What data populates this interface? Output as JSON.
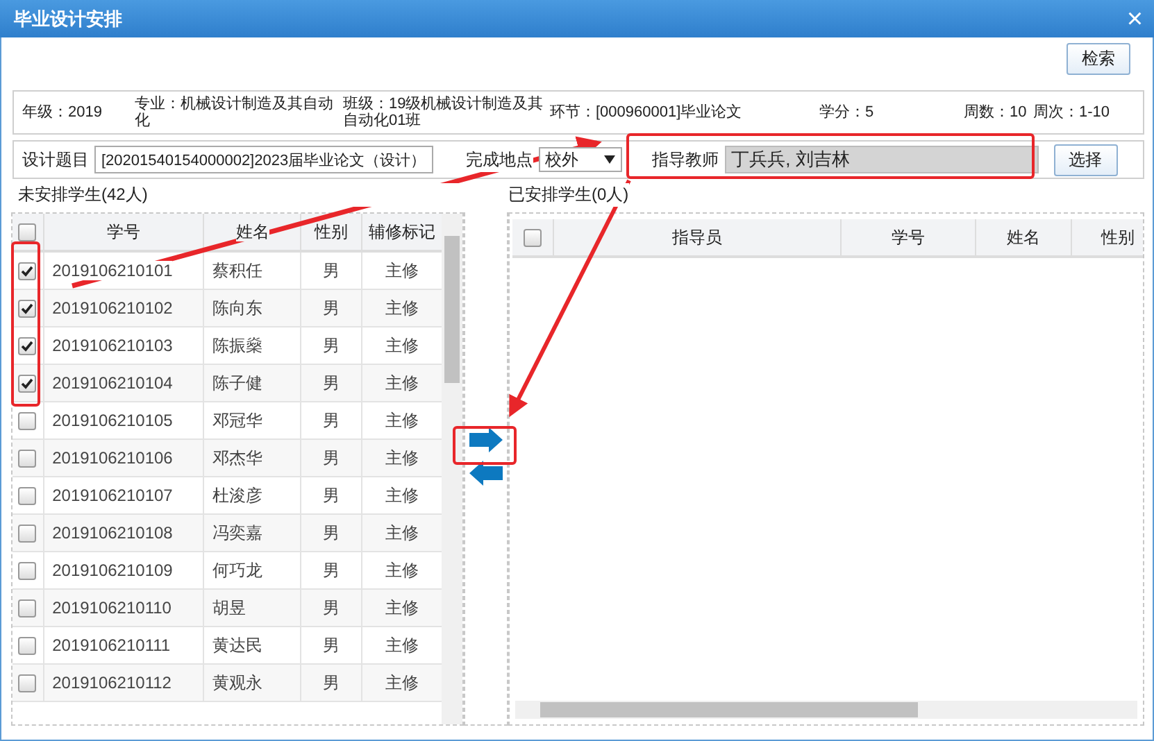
{
  "window": {
    "title": "毕业设计安排",
    "close": "×"
  },
  "toolbar": {
    "search_button": "检索"
  },
  "info": [
    "年级：2019",
    "专业：机械设计制造及其自动化",
    "班级：19级机械设计制造及其自动化01班",
    "环节：[000960001]毕业论文",
    "学分：5",
    "周数：10",
    "周次：1-10"
  ],
  "form": {
    "topic_label": "设计题目",
    "topic_value": "[20201540154000002]2023届毕业论文（设计）",
    "place_label": "完成地点",
    "place_value": "校外",
    "teacher_label": "指导教师",
    "teacher_value": "丁兵兵, 刘吉林",
    "select_button": "选择"
  },
  "unassigned": {
    "title": "未安排学生(42人)",
    "all_checked": false,
    "columns": [
      "学号",
      "姓名",
      "性别",
      "辅修标记"
    ],
    "rows": [
      {
        "id": "2019106210101",
        "name": "蔡积任",
        "gender": "男",
        "mark": "主修",
        "checked": true
      },
      {
        "id": "2019106210102",
        "name": "陈向东",
        "gender": "男",
        "mark": "主修",
        "checked": true
      },
      {
        "id": "2019106210103",
        "name": "陈振燊",
        "gender": "男",
        "mark": "主修",
        "checked": true
      },
      {
        "id": "2019106210104",
        "name": "陈子健",
        "gender": "男",
        "mark": "主修",
        "checked": true
      },
      {
        "id": "2019106210105",
        "name": "邓冠华",
        "gender": "男",
        "mark": "主修",
        "checked": false
      },
      {
        "id": "2019106210106",
        "name": "邓杰华",
        "gender": "男",
        "mark": "主修",
        "checked": false
      },
      {
        "id": "2019106210107",
        "name": "杜浚彦",
        "gender": "男",
        "mark": "主修",
        "checked": false
      },
      {
        "id": "2019106210108",
        "name": "冯奕嘉",
        "gender": "男",
        "mark": "主修",
        "checked": false
      },
      {
        "id": "2019106210109",
        "name": "何巧龙",
        "gender": "男",
        "mark": "主修",
        "checked": false
      },
      {
        "id": "2019106210110",
        "name": "胡昱",
        "gender": "男",
        "mark": "主修",
        "checked": false
      },
      {
        "id": "2019106210111",
        "name": "黄达民",
        "gender": "男",
        "mark": "主修",
        "checked": false
      },
      {
        "id": "2019106210112",
        "name": "黄观永",
        "gender": "男",
        "mark": "主修",
        "checked": false
      }
    ]
  },
  "assigned": {
    "title": "已安排学生(0人)",
    "all_checked": false,
    "columns": [
      "指导员",
      "学号",
      "姓名",
      "性别"
    ]
  }
}
